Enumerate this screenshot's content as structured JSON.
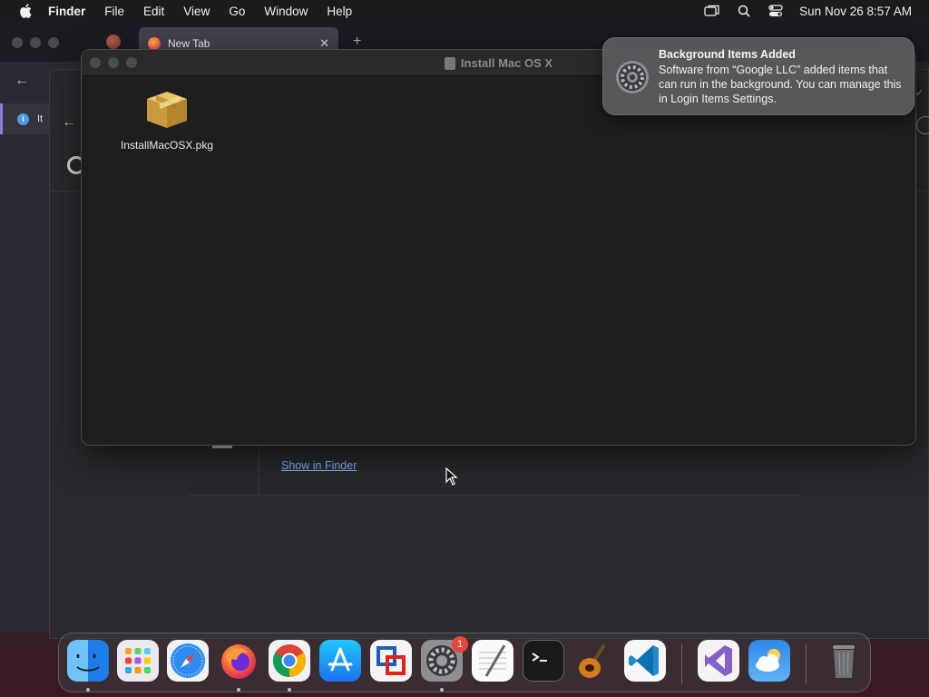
{
  "menubar": {
    "app_name": "Finder",
    "items": [
      "File",
      "Edit",
      "View",
      "Go",
      "Window",
      "Help"
    ],
    "clock": "Sun Nov 26  8:57 AM",
    "status_icons": [
      "screen-mirroring-icon",
      "spotlight-search-icon",
      "control-center-icon"
    ]
  },
  "browser": {
    "active_tab_title": "New Tab",
    "sidebar_tab_label": "It",
    "downloads": {
      "show_in_finder_label": "Show in Finder"
    }
  },
  "finder": {
    "title": "Install Mac OS X",
    "items": [
      {
        "name": "InstallMacOSX.pkg",
        "icon": "package-icon"
      }
    ]
  },
  "notification": {
    "title": "Background Items Added",
    "body": "Software from “Google LLC” added items that can run in the background. You can manage this in Login Items Settings.",
    "icon": "system-settings-gear-icon"
  },
  "dock": {
    "apps": [
      {
        "name": "Finder",
        "running": true
      },
      {
        "name": "Launchpad",
        "running": false
      },
      {
        "name": "Safari",
        "running": false
      },
      {
        "name": "Firefox",
        "running": true
      },
      {
        "name": "Google Chrome",
        "running": true
      },
      {
        "name": "App Store",
        "running": false
      },
      {
        "name": "VMware Fusion",
        "running": false
      },
      {
        "name": "System Settings",
        "running": true,
        "badge": "1"
      },
      {
        "name": "TextEdit",
        "running": false
      },
      {
        "name": "Terminal",
        "running": false
      },
      {
        "name": "GarageBand",
        "running": false
      },
      {
        "name": "Visual Studio Code",
        "running": false
      },
      {
        "name": "Visual Studio",
        "running": false
      },
      {
        "name": "Weather",
        "running": false
      },
      {
        "name": "Trash",
        "running": false
      }
    ]
  }
}
